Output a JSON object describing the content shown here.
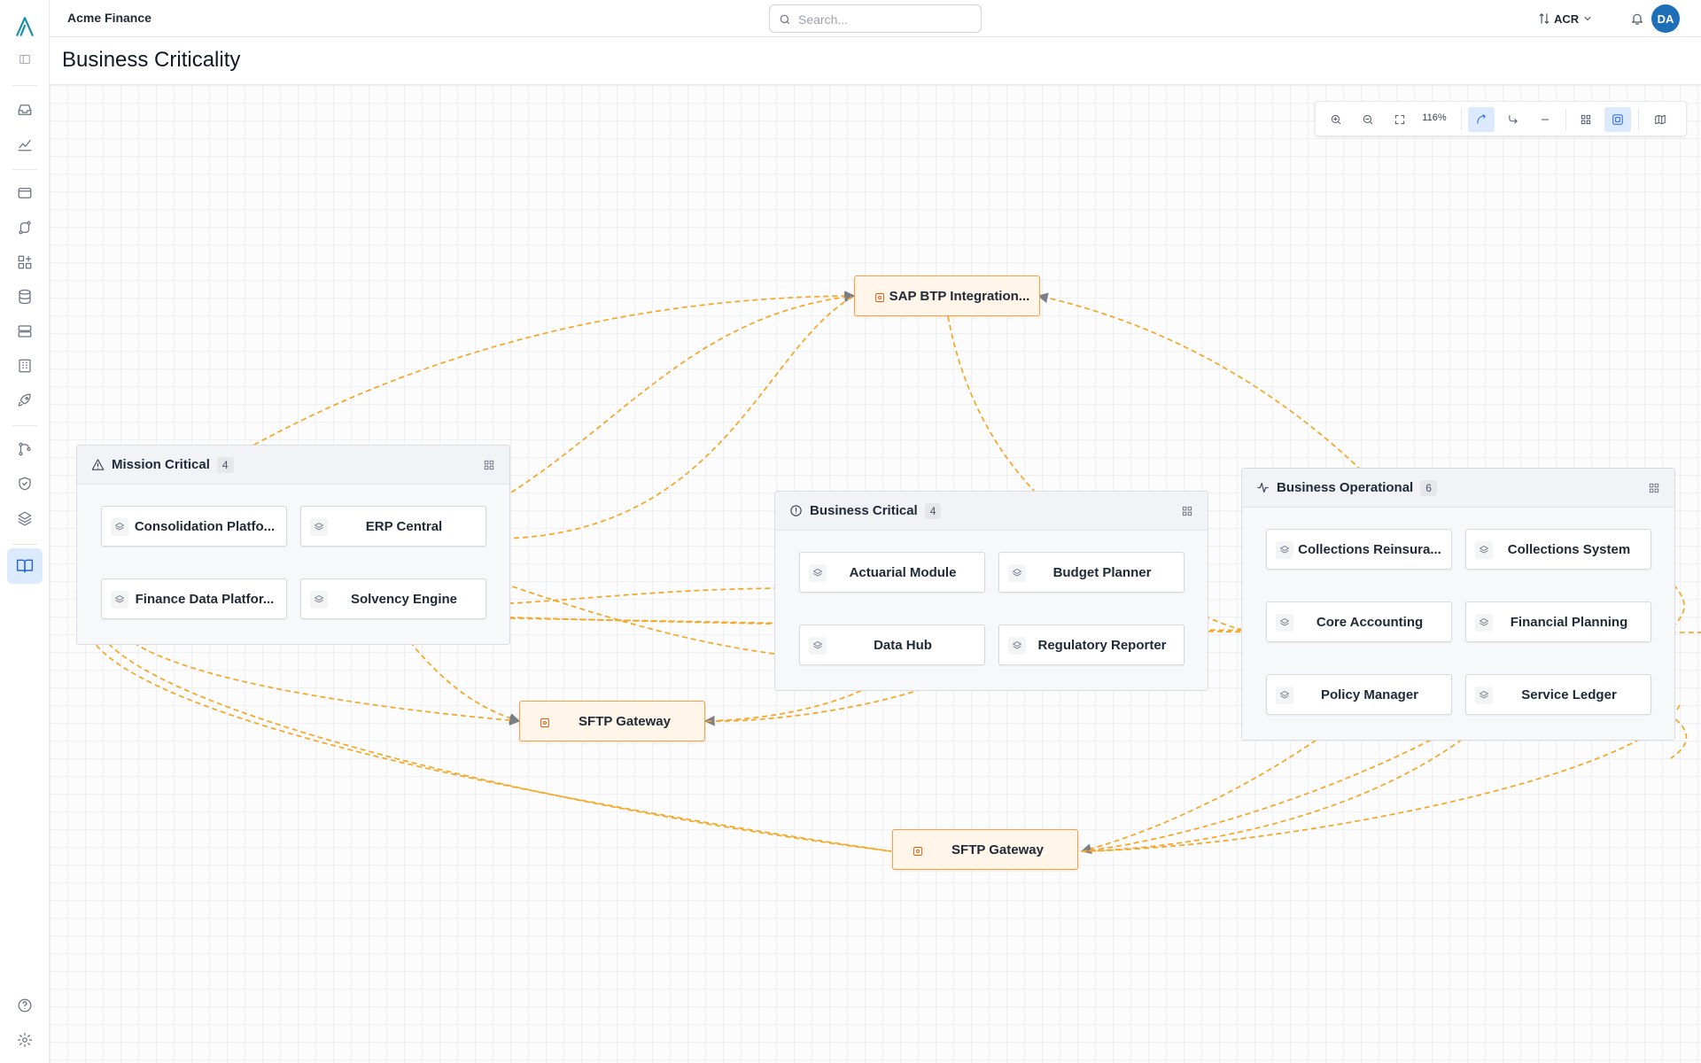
{
  "app": {
    "org_name": "Acme Finance",
    "search_placeholder": "Search...",
    "tenant": "ACR",
    "user_initials": "DA"
  },
  "page": {
    "title": "Business Criticality"
  },
  "toolbar": {
    "zoom_level": "116%"
  },
  "groups": {
    "mission": {
      "name": "Mission Critical",
      "count": "4"
    },
    "critical": {
      "name": "Business Critical",
      "count": "4"
    },
    "operational": {
      "name": "Business Operational",
      "count": "6"
    }
  },
  "nodes": {
    "consolidation": "Consolidation Platfo...",
    "erp": "ERP Central",
    "finance_data": "Finance Data Platfor...",
    "solvency": "Solvency Engine",
    "actuarial": "Actuarial Module",
    "budget": "Budget Planner",
    "data_hub": "Data Hub",
    "regulatory": "Regulatory Reporter",
    "collections_reins": "Collections Reinsura...",
    "collections_system": "Collections System",
    "core_accounting": "Core Accounting",
    "financial_planning": "Financial Planning",
    "policy_manager": "Policy Manager",
    "service_ledger": "Service Ledger"
  },
  "external": {
    "sap": "SAP BTP Integration...",
    "sftp1": "SFTP Gateway",
    "sftp2": "SFTP Gateway"
  },
  "colors": {
    "edge": "#f5a623",
    "accent": "#2563eb",
    "avatar": "#1d6fb8",
    "external_border": "#f2a14a"
  }
}
